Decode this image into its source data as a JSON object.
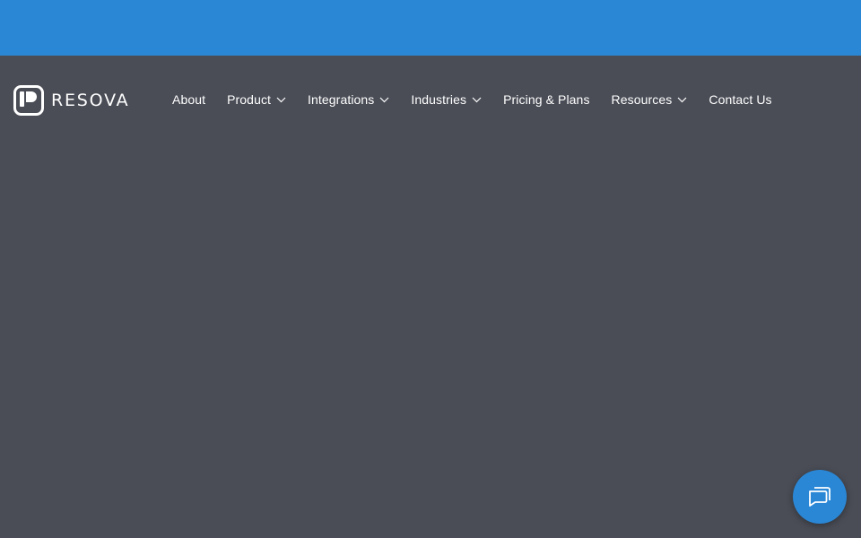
{
  "brand": {
    "name": "RESOVA",
    "banner_color": "#2a87d6",
    "header_color": "#4a4d56"
  },
  "nav": {
    "items": [
      {
        "label": "About",
        "has_dropdown": false
      },
      {
        "label": "Product",
        "has_dropdown": true
      },
      {
        "label": "Integrations",
        "has_dropdown": true
      },
      {
        "label": "Industries",
        "has_dropdown": true
      },
      {
        "label": "Pricing & Plans",
        "has_dropdown": false
      },
      {
        "label": "Resources",
        "has_dropdown": true
      },
      {
        "label": "Contact Us",
        "has_dropdown": false
      }
    ]
  },
  "chat": {
    "icon": "chat-bubbles-icon",
    "color": "#2a87d6"
  }
}
